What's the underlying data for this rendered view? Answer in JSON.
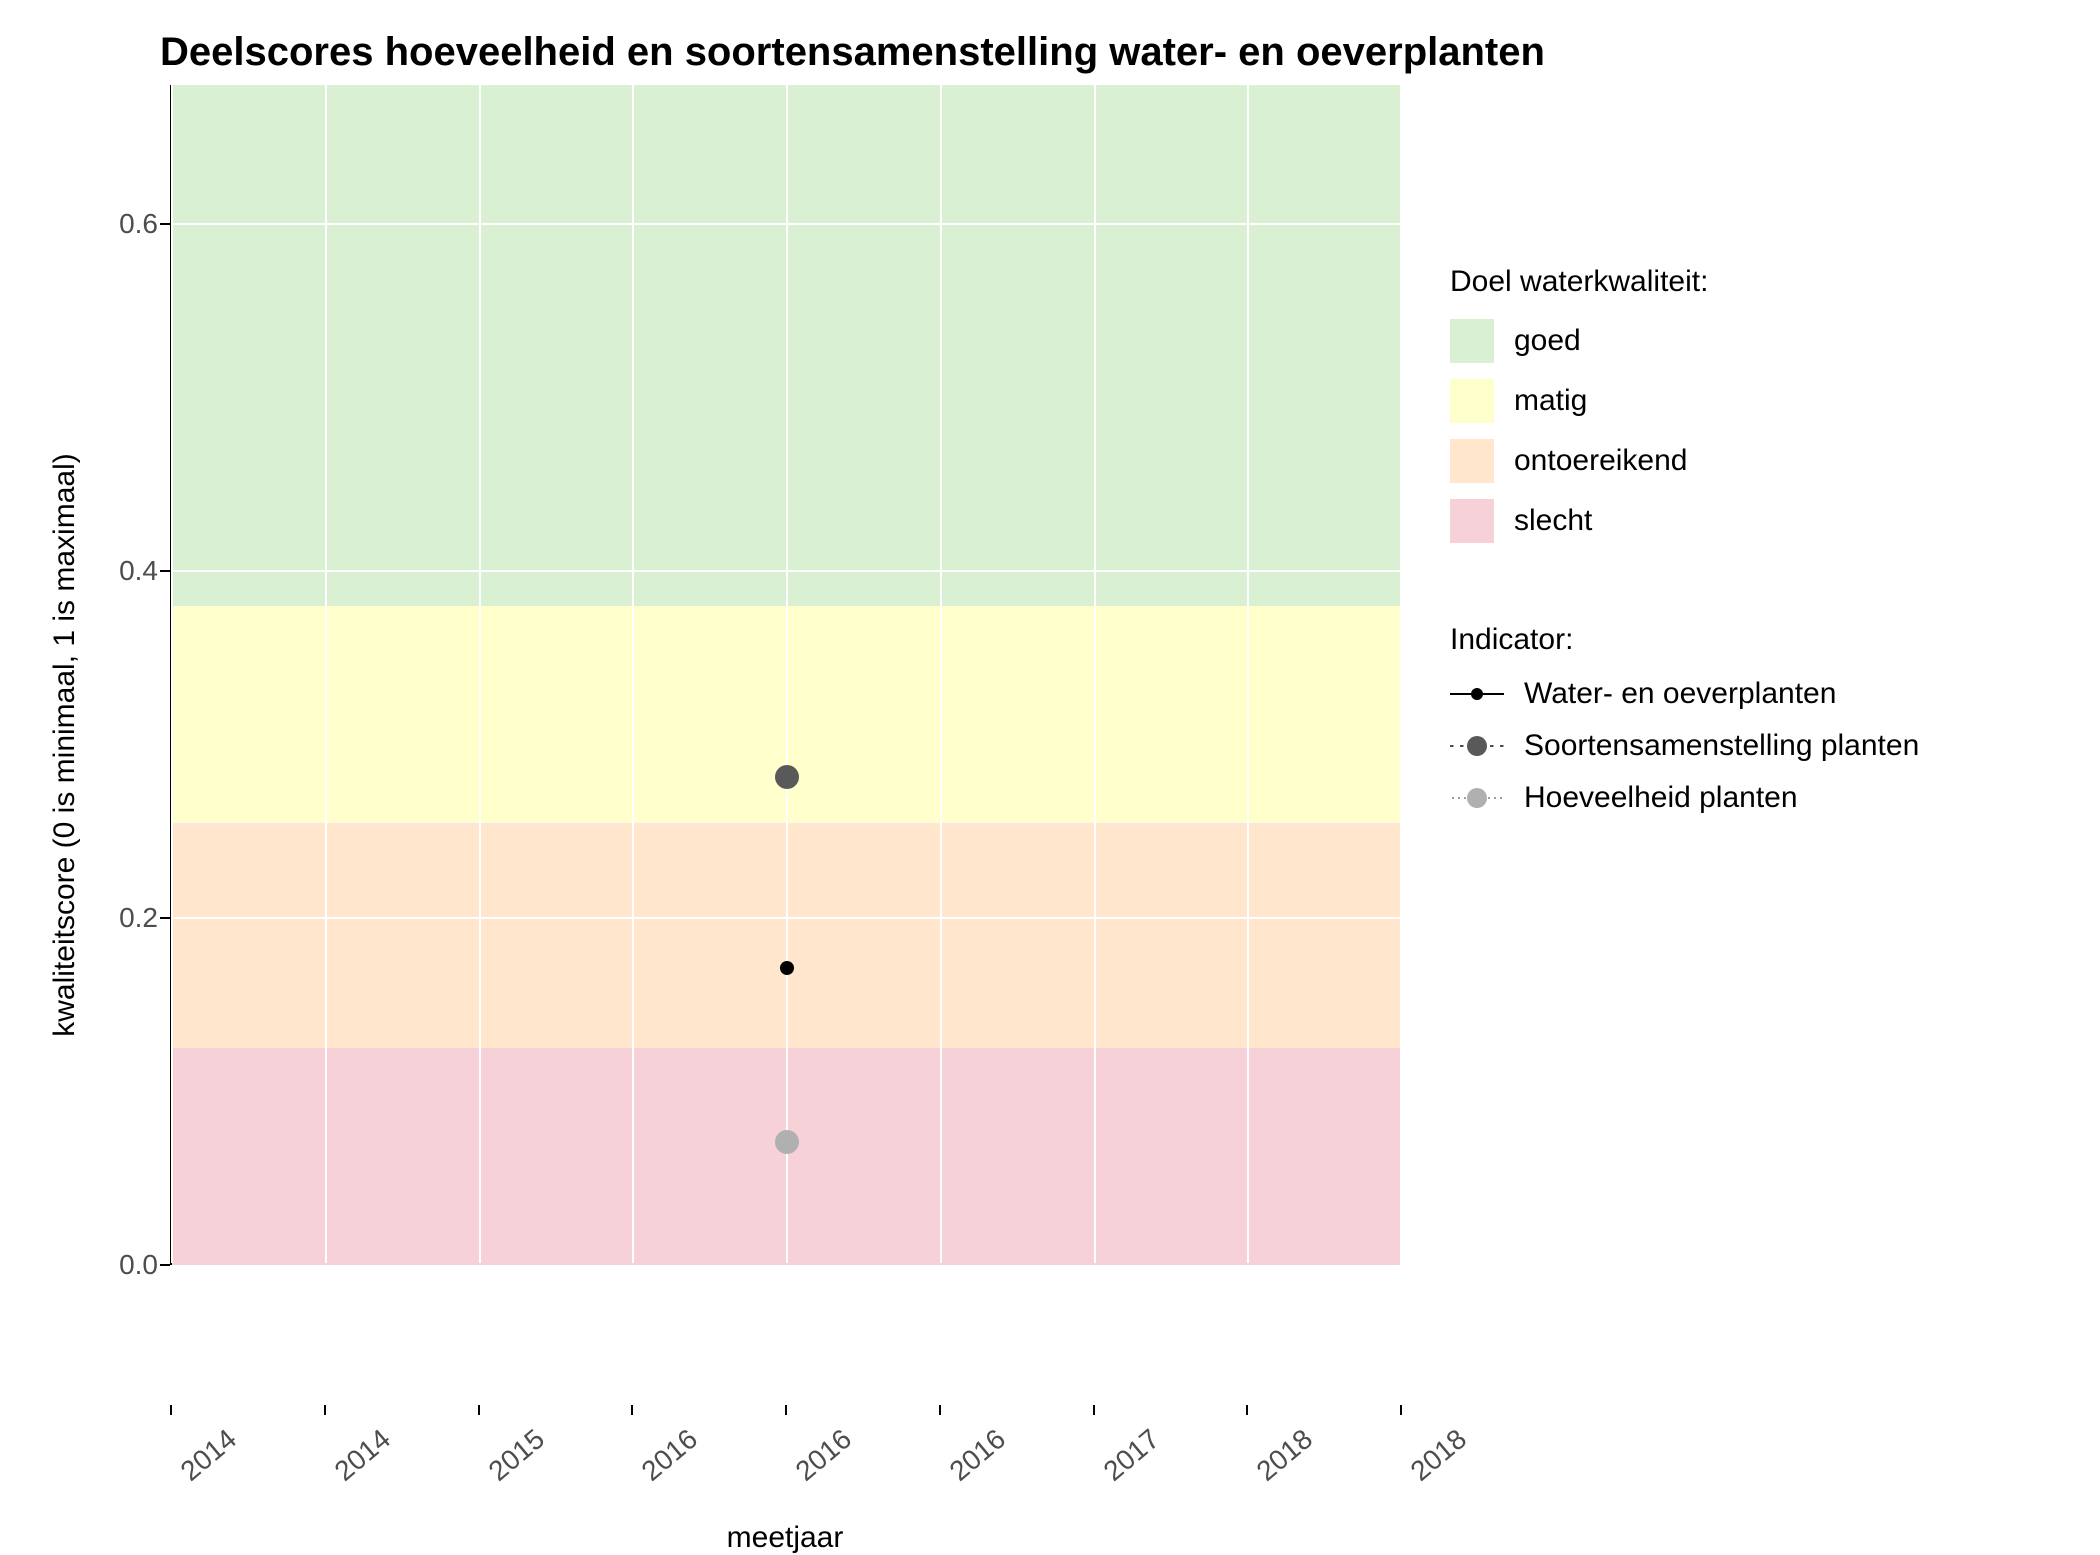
{
  "chart_data": {
    "type": "scatter",
    "title": "Deelscores hoeveelheid en soortensamenstelling water- en oeverplanten",
    "xlabel": "meetjaar",
    "ylabel": "kwaliteitscore (0 is minimaal, 1 is maximaal)",
    "xlim": [
      2013.6,
      2018.4
    ],
    "ylim": [
      0.0,
      0.68
    ],
    "x_ticks": [
      "2014",
      "2014",
      "2015",
      "2016",
      "2016",
      "2016",
      "2017",
      "2018",
      "2018"
    ],
    "x_tick_vals": [
      2013.6,
      2014.2,
      2014.8,
      2015.4,
      2016.0,
      2016.6,
      2017.2,
      2017.8,
      2018.4
    ],
    "y_ticks": [
      0.0,
      0.2,
      0.4,
      0.6
    ],
    "bands": [
      {
        "name": "goed",
        "from": 0.38,
        "to": 0.68,
        "color": "#d9f0d3"
      },
      {
        "name": "matig",
        "from": 0.255,
        "to": 0.38,
        "color": "#ffffcc"
      },
      {
        "name": "ontoereikend",
        "from": 0.125,
        "to": 0.255,
        "color": "#ffe6cc"
      },
      {
        "name": "slecht",
        "from": 0.0,
        "to": 0.125,
        "color": "#f7d1d8"
      }
    ],
    "series": [
      {
        "name": "Water- en oeverplanten",
        "style": "small-black",
        "x": [
          2016
        ],
        "y": [
          0.17
        ]
      },
      {
        "name": "Soortensamenstelling planten",
        "style": "big-darkgrey",
        "x": [
          2016
        ],
        "y": [
          0.28
        ]
      },
      {
        "name": "Hoeveelheid planten",
        "style": "big-lightgrey",
        "x": [
          2016
        ],
        "y": [
          0.07
        ]
      }
    ]
  },
  "legend": {
    "quality_title": "Doel waterkwaliteit:",
    "quality_items": [
      {
        "label": "goed",
        "cls": "sw-goed"
      },
      {
        "label": "matig",
        "cls": "sw-matig"
      },
      {
        "label": "ontoereikend",
        "cls": "sw-ontoereikend"
      },
      {
        "label": "slecht",
        "cls": "sw-slecht"
      }
    ],
    "indicator_title": "Indicator:",
    "indicator_items": [
      {
        "label": "Water- en oeverplanten"
      },
      {
        "label": "Soortensamenstelling planten"
      },
      {
        "label": "Hoeveelheid planten"
      }
    ]
  }
}
